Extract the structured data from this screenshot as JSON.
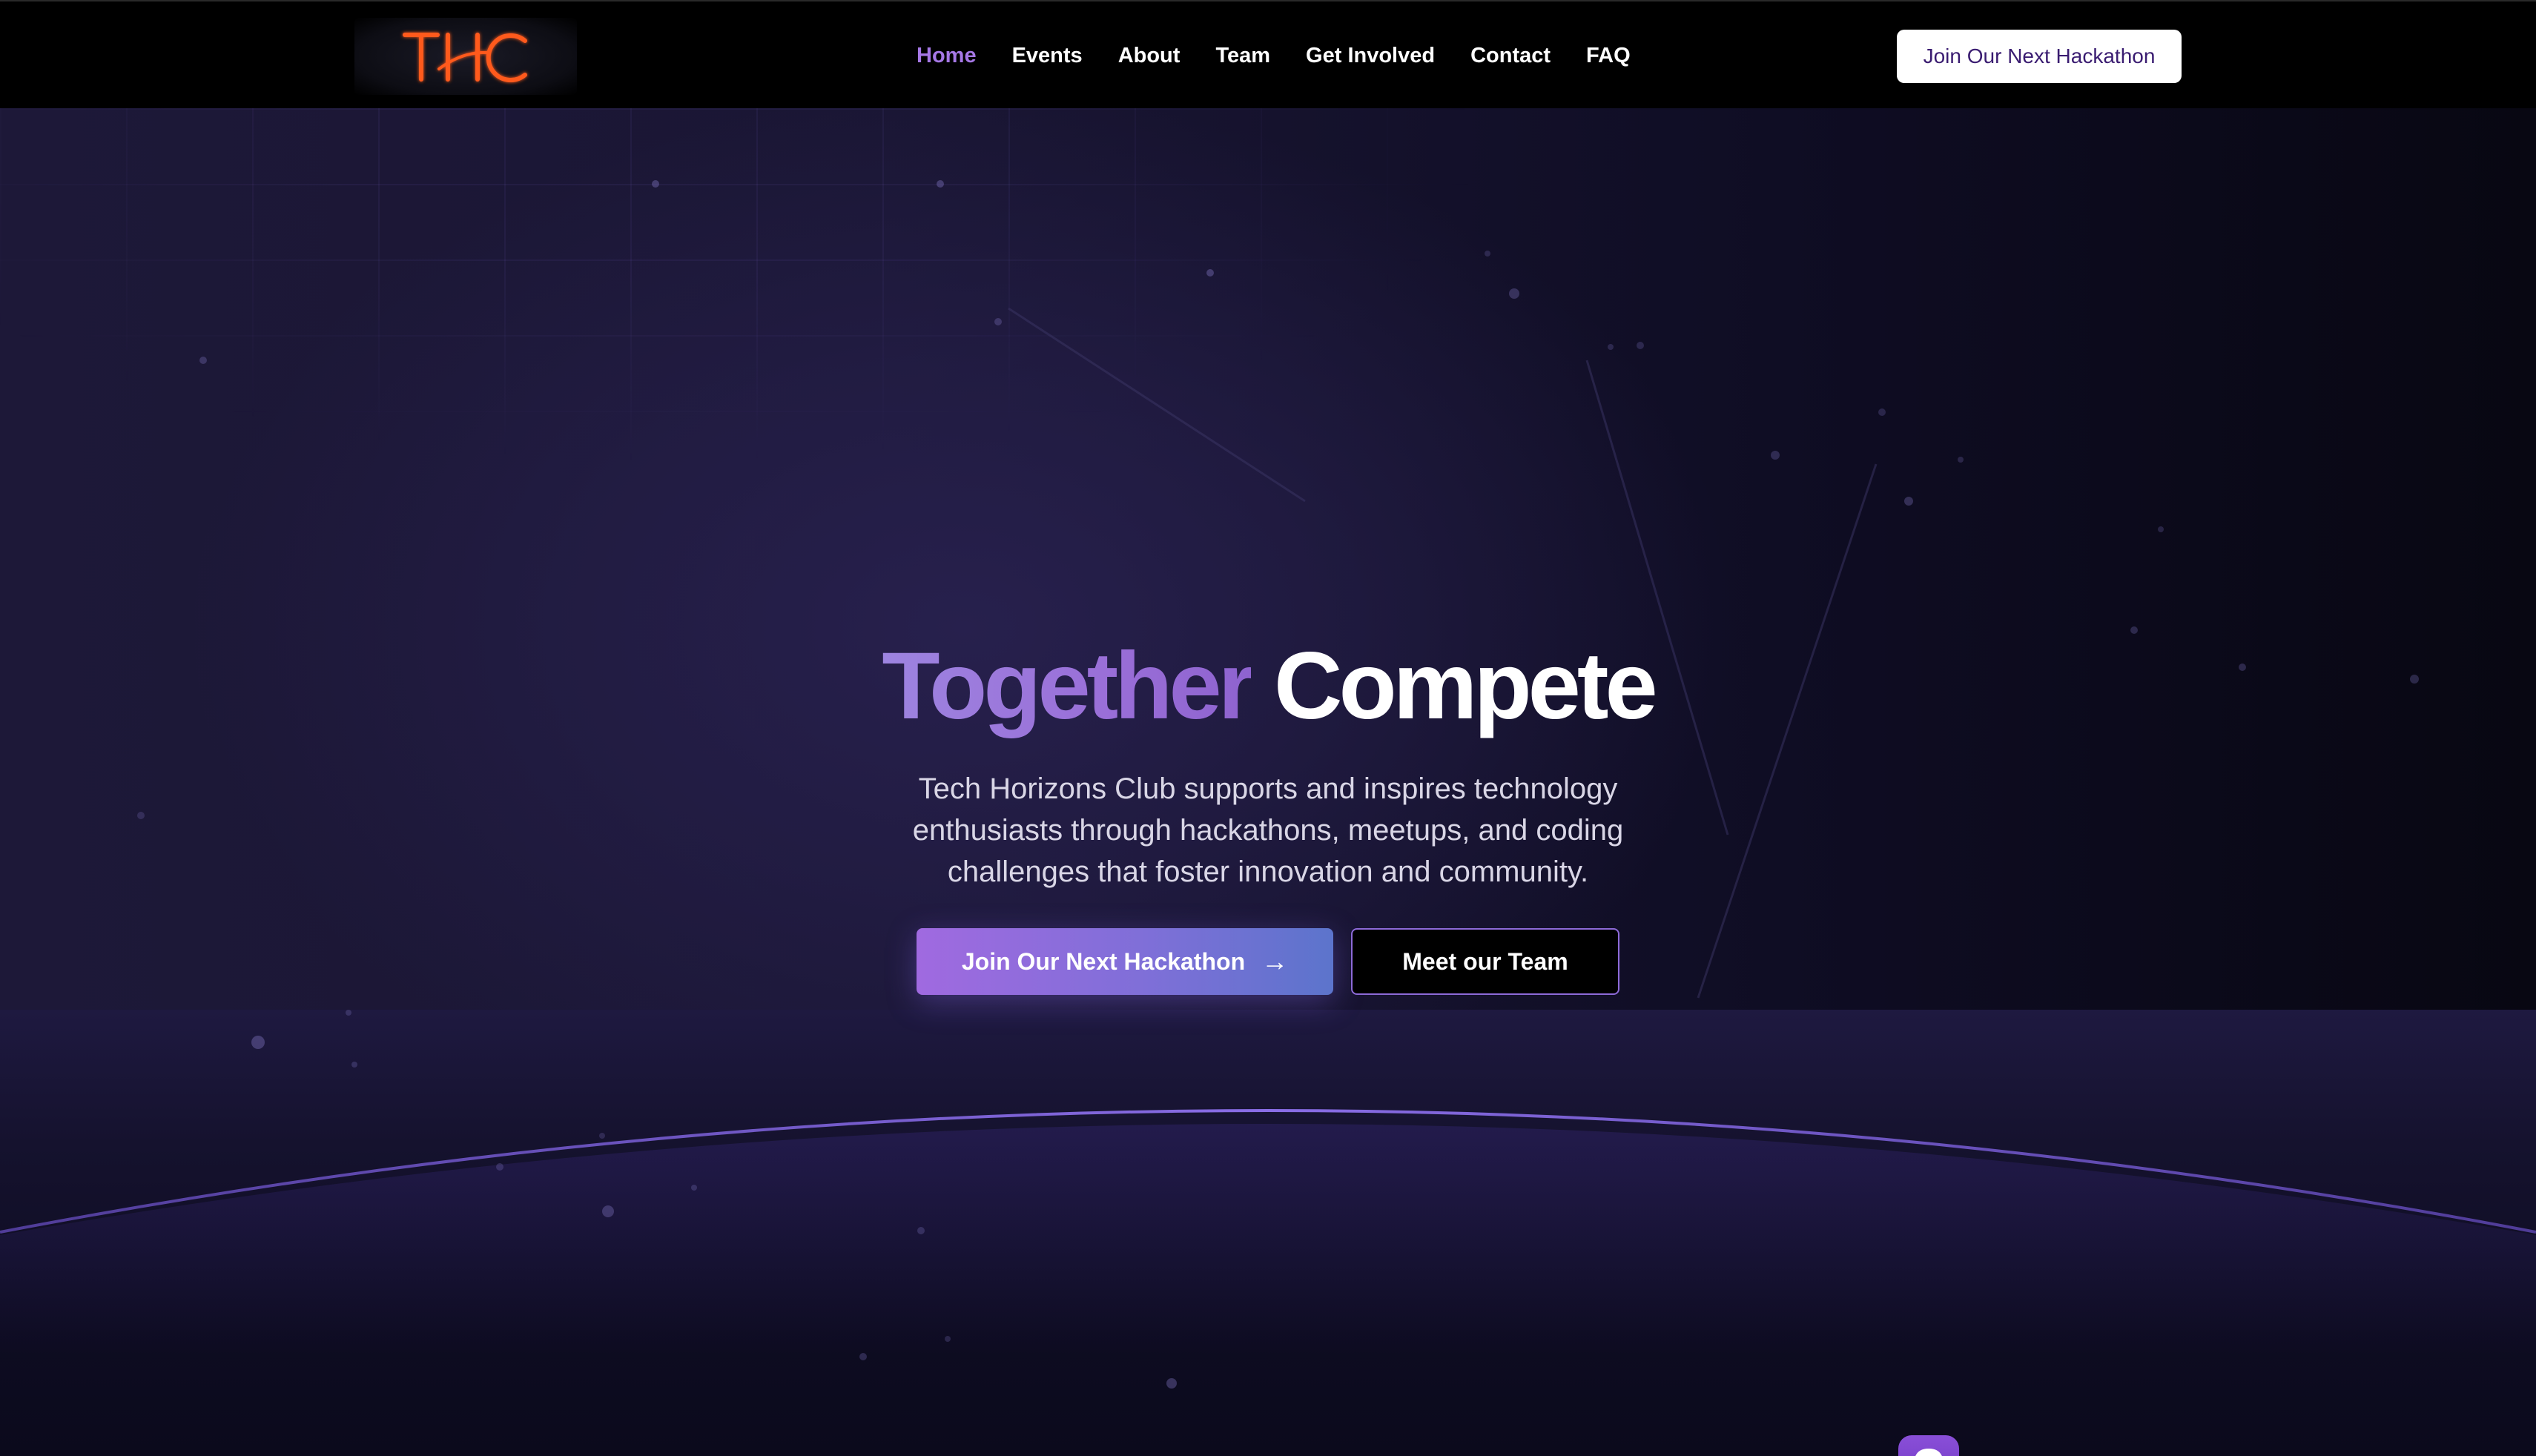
{
  "nav": {
    "logo_text": "THC",
    "links": [
      {
        "label": "Home",
        "active": true
      },
      {
        "label": "Events",
        "active": false
      },
      {
        "label": "About",
        "active": false
      },
      {
        "label": "Team",
        "active": false
      },
      {
        "label": "Get Involved",
        "active": false
      },
      {
        "label": "Contact",
        "active": false
      },
      {
        "label": "FAQ",
        "active": false
      }
    ],
    "cta_label": "Join Our Next Hackathon"
  },
  "hero": {
    "title_accent": "Together",
    "title_main": "Compete",
    "description": "Tech Horizons Club supports and inspires technology enthusiasts through hackathons, meetups, and coding challenges that foster innovation and community.",
    "primary_button_label": "Join Our Next Hackathon",
    "primary_button_icon": "arrow-right-icon",
    "primary_button_arrow": "→",
    "secondary_button_label": "Meet our Team"
  },
  "chat_widget": {
    "icon": "chat-bot-icon"
  },
  "colors": {
    "accent": "#a678e6",
    "nav_bg": "#000000",
    "logo": "#ff5a1f",
    "cta_text": "#3a1c71",
    "gradient_start": "#a06ae0",
    "gradient_end": "#5c74cc"
  }
}
